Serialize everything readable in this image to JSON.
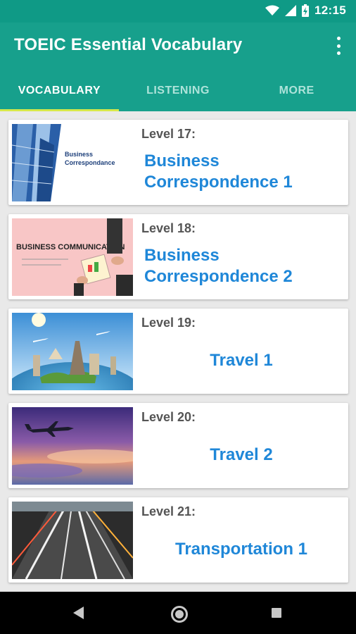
{
  "status_bar": {
    "time": "12:15"
  },
  "app_bar": {
    "title": "TOEIC Essential Vocabulary"
  },
  "tabs": [
    {
      "label": "VOCABULARY",
      "active": true
    },
    {
      "label": "LISTENING",
      "active": false
    },
    {
      "label": "MORE",
      "active": false
    }
  ],
  "levels": [
    {
      "level": "Level 17:",
      "title": "Business Correspondence 1",
      "thumb_text": "Business Correspondance"
    },
    {
      "level": "Level 18:",
      "title": "Business Correspondence 2",
      "thumb_text": "BUSINESS COMMUNICATION"
    },
    {
      "level": "Level 19:",
      "title": "Travel 1"
    },
    {
      "level": "Level 20:",
      "title": "Travel 2"
    },
    {
      "level": "Level 21:",
      "title": "Transportation 1"
    }
  ],
  "colors": {
    "primary": "#17a08c",
    "status": "#0f9a86",
    "accent": "#d7e84a",
    "title_blue": "#1f87d8"
  }
}
